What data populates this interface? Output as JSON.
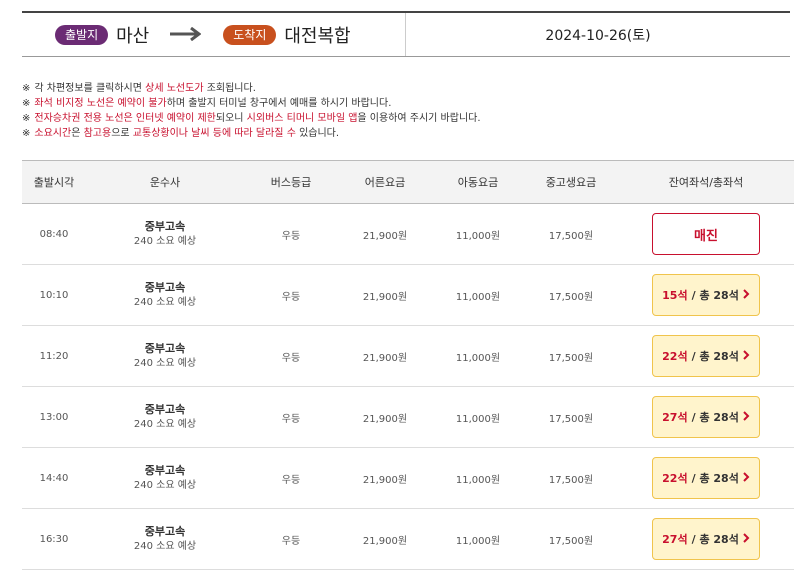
{
  "route": {
    "departure_badge": "출발지",
    "departure": "마산",
    "arrival_badge": "도착지",
    "arrival": "대전복합",
    "date": "2024-10-26(토)"
  },
  "notices": [
    [
      {
        "t": "각 차편정보를 클릭하시면 "
      },
      {
        "t": "상세 노선도가",
        "r": true
      },
      {
        "t": " 조회됩니다."
      }
    ],
    [
      {
        "t": "좌석 비지정 노선은 예약이 불가",
        "r": true
      },
      {
        "t": "하며 출발지 터미널 창구에서 예매를 하시기 바랍니다."
      }
    ],
    [
      {
        "t": "전자승차권 전용 노선은 인터넷 예약이 제한",
        "r": true
      },
      {
        "t": "되오니 "
      },
      {
        "t": "시외버스 티머니 모바일 앱",
        "r": true
      },
      {
        "t": "을 이용하여 주시기 바랍니다."
      }
    ],
    [
      {
        "t": "소요시간",
        "r": true
      },
      {
        "t": "은 "
      },
      {
        "t": "참고용",
        "r": true
      },
      {
        "t": "으로 "
      },
      {
        "t": "교통상황이나 날씨 등에 따라 달라질 수",
        "r": true
      },
      {
        "t": " 있습니다."
      }
    ]
  ],
  "notice_mark": "※",
  "table": {
    "headers": [
      "출발시각",
      "운수사",
      "버스등급",
      "어른요금",
      "아동요금",
      "중고생요금",
      "잔여좌석/총좌석"
    ],
    "soldout_label": "매진",
    "seat_unit": "석",
    "total_prefix": "/ 총",
    "rows": [
      {
        "time": "08:40",
        "company": "중부고속",
        "duration": "240 소요 예상",
        "grade": "우등",
        "adult": "21,900원",
        "child": "11,000원",
        "youth": "17,500원",
        "soldout": true
      },
      {
        "time": "10:10",
        "company": "중부고속",
        "duration": "240 소요 예상",
        "grade": "우등",
        "adult": "21,900원",
        "child": "11,000원",
        "youth": "17,500원",
        "remain": "15석",
        "total": "28석"
      },
      {
        "time": "11:20",
        "company": "중부고속",
        "duration": "240 소요 예상",
        "grade": "우등",
        "adult": "21,900원",
        "child": "11,000원",
        "youth": "17,500원",
        "remain": "22석",
        "total": "28석"
      },
      {
        "time": "13:00",
        "company": "중부고속",
        "duration": "240 소요 예상",
        "grade": "우등",
        "adult": "21,900원",
        "child": "11,000원",
        "youth": "17,500원",
        "remain": "27석",
        "total": "28석"
      },
      {
        "time": "14:40",
        "company": "중부고속",
        "duration": "240 소요 예상",
        "grade": "우등",
        "adult": "21,900원",
        "child": "11,000원",
        "youth": "17,500원",
        "remain": "22석",
        "total": "28석"
      },
      {
        "time": "16:30",
        "company": "중부고속",
        "duration": "240 소요 예상",
        "grade": "우등",
        "adult": "21,900원",
        "child": "11,000원",
        "youth": "17,500원",
        "remain": "27석",
        "total": "28석"
      }
    ]
  },
  "colors": {
    "departure_badge": "#6b2b74",
    "arrival_badge": "#c8501e",
    "accent_red": "#c8102e",
    "seat_button_bg": "#fff4cc"
  },
  "icons": {
    "route_arrow": "right-arrow-icon",
    "seat_chevron": "chevron-right-icon"
  }
}
